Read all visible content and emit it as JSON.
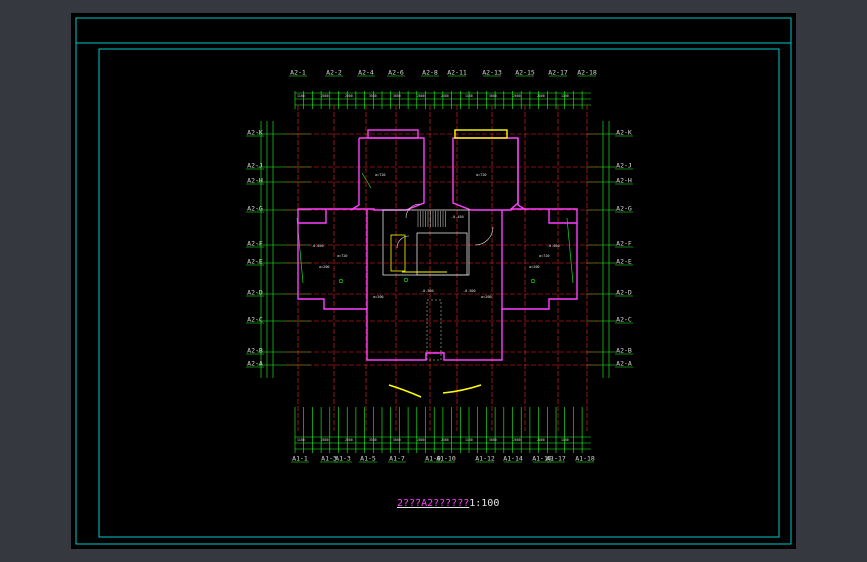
{
  "drawing": {
    "title_name": "2???A2??????",
    "title_scale": "1:100"
  },
  "colors": {
    "background": "#000000",
    "frame": "#00c8c8",
    "axis": "#ff2020",
    "dimension": "#20ff20",
    "wall": "#ff40ff",
    "text": "#e0e0e0",
    "highlight": "#ffff00"
  },
  "grid": {
    "top_axes": [
      "A2-1",
      "A2-2",
      "A2-4",
      "A2-6",
      "A2-8",
      "A2-11",
      "A2-13",
      "A2-15",
      "A2-17",
      "A2-18"
    ],
    "bottom_axes": [
      "A1-1",
      "A1-3",
      "A1-3",
      "A1-5",
      "A1-7",
      "A1-9",
      "A1-10",
      "A1-12",
      "A1-14",
      "A1-16",
      "A1-17",
      "A1-18"
    ],
    "left_axes": [
      "A2-K",
      "A2-J",
      "A2-H",
      "A2-G",
      "A2-F",
      "A2-E",
      "A2-D",
      "A2-C",
      "A2-B",
      "A2-A"
    ],
    "right_axes": [
      "A2-K",
      "A2-J",
      "A2-H",
      "A2-G",
      "A2-F",
      "A2-E",
      "A2-D",
      "A2-C",
      "A2-B",
      "A2-A"
    ]
  },
  "annotations": {
    "level_marks": [
      "-0.050",
      "-0.050",
      "-0.450",
      "-0.500",
      "-0.500"
    ],
    "room_labels": [
      "a=720",
      "a=720",
      "a=720",
      "a=720",
      "a=200",
      "a=200",
      "a=200",
      "a=200"
    ]
  }
}
